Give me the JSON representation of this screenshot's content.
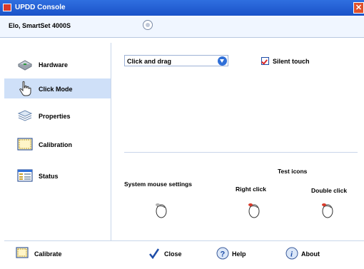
{
  "window": {
    "title": "UPDD Console",
    "close_glyph": "✕"
  },
  "device": {
    "name": "Elo, SmartSet 4000S"
  },
  "sidebar": {
    "items": [
      {
        "label": "Hardware",
        "icon": "hardware-icon"
      },
      {
        "label": "Click Mode",
        "icon": "hand-pointer-icon",
        "active": true
      },
      {
        "label": "Properties",
        "icon": "properties-icon"
      },
      {
        "label": "Calibration",
        "icon": "calibration-icon"
      },
      {
        "label": "Status",
        "icon": "status-icon"
      }
    ]
  },
  "main": {
    "click_mode_value": "Click and drag",
    "silent_touch_label": "Silent touch",
    "silent_touch_checked": true,
    "test_icons_label": "Test icons",
    "system_mouse_label": "System mouse settings",
    "right_click_label": "Right click",
    "double_click_label": "Double click"
  },
  "footer": {
    "calibrate_label": "Calibrate",
    "close_label": "Close",
    "help_label": "Help",
    "about_label": "About"
  },
  "colors": {
    "titlebar": "#1f5ad0",
    "accent": "#2f6fd8",
    "selection": "#cfe0f8",
    "check": "#d92a2a"
  }
}
